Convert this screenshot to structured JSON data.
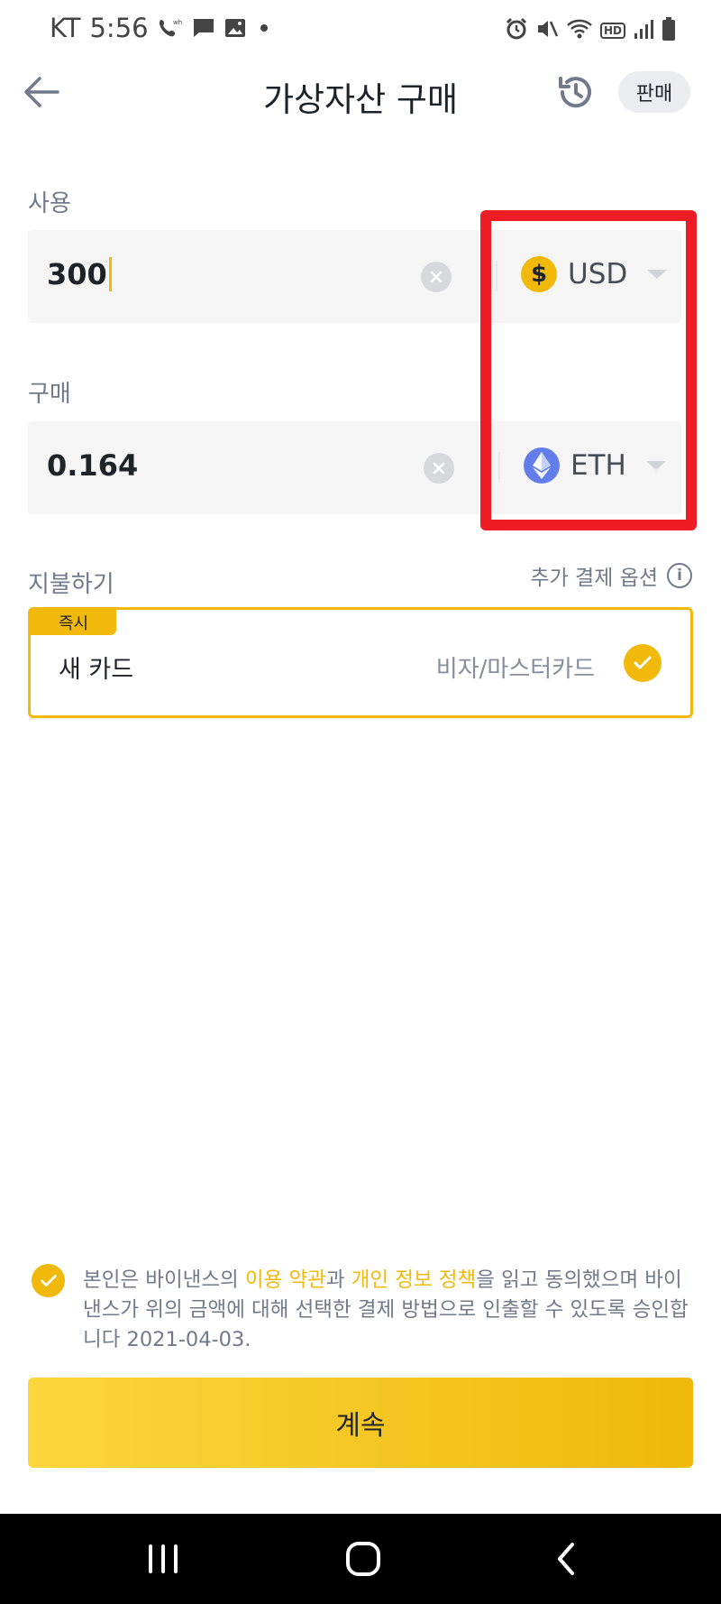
{
  "status_bar": {
    "carrier": "KT",
    "time": "5:56",
    "icons_left": [
      "wifi-call-icon",
      "message-icon",
      "gallery-icon",
      "dot-icon"
    ],
    "icons_right": [
      "alarm-icon",
      "mute-icon",
      "wifi-icon",
      "hd-icon",
      "signal-icon",
      "battery-icon"
    ],
    "hd_label": "HD"
  },
  "header": {
    "title": "가상자산 구매",
    "sell_label": "판매"
  },
  "spend": {
    "label": "사용",
    "value": "300",
    "currency": "USD",
    "coin_symbol": "$"
  },
  "receive": {
    "label": "구매",
    "value": "0.164",
    "currency": "ETH"
  },
  "payment": {
    "label": "지불하기",
    "more_options": "추가 결제 옵션",
    "info_symbol": "i",
    "badge": "즉시",
    "method_name": "새 카드",
    "method_types": "비자/마스터카드"
  },
  "agreement": {
    "part1": "본인은 바이낸스의 ",
    "terms_link": "이용 약관",
    "part2": "과 ",
    "privacy_link": "개인 정보 정책",
    "part3": "을 읽고 동의했으며 바이낸스가 위의 금액에 대해 선택한 결제 방법으로 인출할 수 있도록 승인합니다 2021-04-03."
  },
  "continue_label": "계속",
  "colors": {
    "accent": "#f0b90b",
    "highlight": "#ee1c25",
    "usd_coin": "#f0b90b",
    "eth_coin": "#627eea"
  }
}
